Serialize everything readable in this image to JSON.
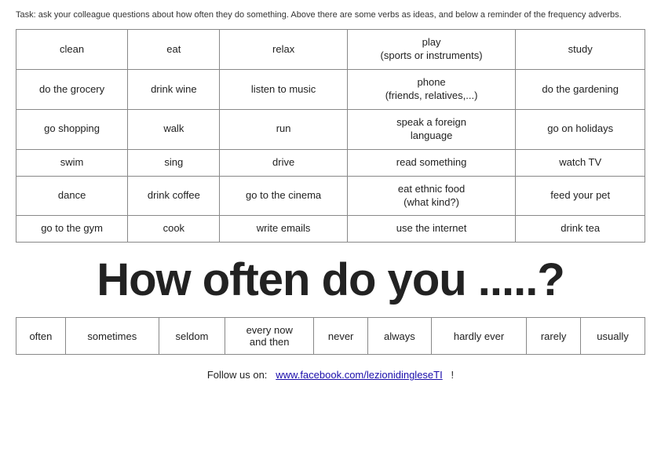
{
  "task": {
    "text": "Task: ask your colleague questions about how often they do something. Above there are some verbs as ideas, and below a reminder of the frequency adverbs."
  },
  "verbs_table": {
    "rows": [
      [
        "clean",
        "eat",
        "relax",
        "play\n(sports or instruments)",
        "study"
      ],
      [
        "do the grocery",
        "drink wine",
        "listen to music",
        "phone\n(friends, relatives,...)",
        "do the gardening"
      ],
      [
        "go shopping",
        "walk",
        "run",
        "speak a foreign\nlanguage",
        "go on holidays"
      ],
      [
        "swim",
        "sing",
        "drive",
        "read something",
        "watch TV"
      ],
      [
        "dance",
        "drink coffee",
        "go to the cinema",
        "eat ethnic food\n(what kind?)",
        "feed your pet"
      ],
      [
        "go to the gym",
        "cook",
        "write emails",
        "use the internet",
        "drink tea"
      ]
    ]
  },
  "heading": "How often do you .....?",
  "frequency": {
    "adverbs": [
      "often",
      "sometimes",
      "seldom",
      "every now\nand then",
      "never",
      "always",
      "hardly ever",
      "rarely",
      "usually"
    ]
  },
  "follow_us": {
    "label": "Follow us on:",
    "link_text": "www.facebook.com/lezionidingleseTI",
    "link_url": "#",
    "exclamation": "!"
  }
}
